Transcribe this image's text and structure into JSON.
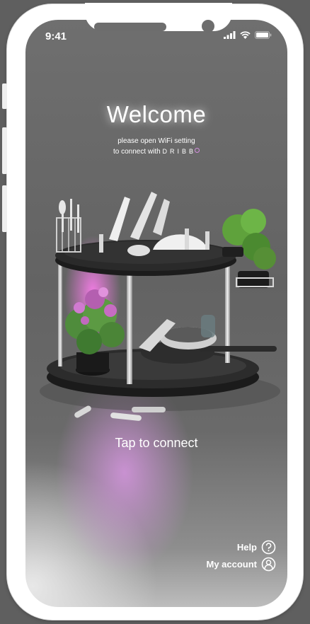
{
  "status_bar": {
    "time": "9:41"
  },
  "welcome": {
    "title": "Welcome",
    "line1": "please open WiFi setting",
    "line2": "to connect with",
    "brand": "DRIBB"
  },
  "cta": {
    "label": "Tap to connect"
  },
  "links": {
    "help": "Help",
    "account": "My account"
  },
  "colors": {
    "accent_glow": "#d48ee0",
    "screen_bg": "#666666",
    "frame": "#ffffff"
  },
  "icons": [
    "signal-icon",
    "wifi-icon",
    "battery-icon",
    "help-icon",
    "account-icon"
  ]
}
